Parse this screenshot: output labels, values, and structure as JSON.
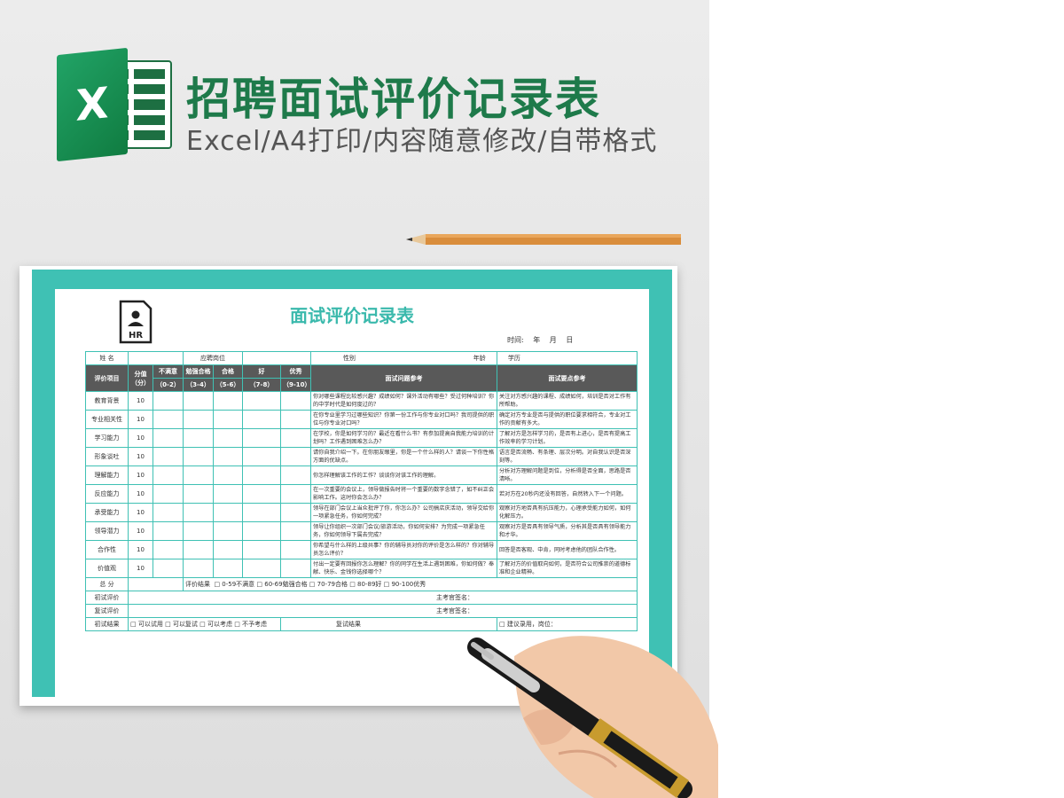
{
  "hero": {
    "title": "招聘面试评价记录表",
    "subtitle": "Excel/A4打印/内容随意修改/自带格式",
    "logo_letter": "X"
  },
  "sheet": {
    "title": "面试评价记录表",
    "hr_icon": "HR",
    "date_line": "时间: 年 月 日",
    "header_row": {
      "name": "姓 名",
      "position": "应聘岗位",
      "gender": "性别",
      "age": "年龄",
      "education": "学历"
    },
    "cols": {
      "item": "评价项目",
      "score": "分值",
      "score_unit": "（分）",
      "bad": "不满意",
      "bad_range": "（0-2）",
      "pass_weak": "勉强合格",
      "pass_weak_range": "（3-4）",
      "pass": "合格",
      "pass_range": "（5-6）",
      "good": "好",
      "good_range": "（7-8）",
      "excellent": "优秀",
      "excellent_range": "（9-10）",
      "questions": "面试问题参考",
      "points": "面试要点参考"
    },
    "rows": [
      {
        "item": "教育背景",
        "score": "10",
        "q": "你对哪些课程比较感兴趣？成绩如何？课外活动有哪些？受过何种培训？你的中学时代是如何度过的？",
        "p": "关注对方感兴趣的课程、成绩如何，培训是否对工作有所帮助。"
      },
      {
        "item": "专业相关性",
        "score": "10",
        "q": "在你专业里学习过哪些知识？你第一份工作与你专业对口吗？我司提供的职位与你专业对口吗？",
        "p": "确定对方专业是否与提供的职位要求相符合，专业对工作的贡献有多大。"
      },
      {
        "item": "学习能力",
        "score": "10",
        "q": "在学校，你是如何学习的？最近在看什么书？有参加提高自我能力培训的计划吗？工作遇到困难怎么办？",
        "p": "了解对方是怎样学习的，是否有上进心，是否有提高工作效率的学习计划。"
      },
      {
        "item": "形象谈吐",
        "score": "10",
        "q": "请你自我介绍一下。在你朋友眼里，你是一个什么样的人？请谈一下你性格方面的优缺点。",
        "p": "语言是否流畅、有条理、层次分明。对自我认识是否深刻等。"
      },
      {
        "item": "理解能力",
        "score": "10",
        "q": "你怎样理解该工作的工作？谈谈你对该工作的理解。",
        "p": "分析对方理解问题是到位，分析得是否全面，思路是否清晰。"
      },
      {
        "item": "反应能力",
        "score": "10",
        "q": "在一次重要的会议上，领导做报告时将一个重要的数字念错了，如不纠正会影响工作。这时你会怎么办？",
        "p": "若对方在20秒内还没有回答，自然转入下一个问题。"
      },
      {
        "item": "承受能力",
        "score": "10",
        "q": "领导在部门会议上当众批评了你，你怎么办？公司搞店庆活动，领导交给你一项紧急任务，你如何完成？",
        "p": "观察对方地否具有抗压能力，心理承受能力如何，如何化解压力。"
      },
      {
        "item": "领导潜力",
        "score": "10",
        "q": "领导让你组织一次部门会议/旅游活动，你如何安排？为完成一项紧急任务，你如何领导下属去完成？",
        "p": "观察对方是否具有领导气质，分析其是否具有领导能力和才华。"
      },
      {
        "item": "合作性",
        "score": "10",
        "q": "你希望与什么样的上级共事？你的辅导员对你的评价是怎么样的？你对辅导员怎么评价？",
        "p": "回答是否客观、中肯，同时考虑他的团队合作性。"
      },
      {
        "item": "价值观",
        "score": "10",
        "q": "付出一定要有回报你怎么理解？你的同学在生活上遇到困难，你如何做？奉献、快乐、金钱你选择哪个？",
        "p": "了解对方的价值取向如何，是否符合公司推崇的道德标准和企业精神。"
      }
    ],
    "total_label": "总 分",
    "result_label": "评价结果",
    "result_options": "□ 0-59不满意 □ 60-69勉强合格 □ 70-79合格 □ 80-89好 □ 90-100优秀",
    "first_eval": "初试评价",
    "second_eval": "复试评价",
    "signature": "主考官签名：",
    "first_result": "初试结果",
    "first_result_options": "□ 可以试用 □ 可以复试 □ 可以考虑 □ 不予考虑",
    "second_result": "复试结果",
    "second_result_options": "□ 建议录用，岗位："
  }
}
